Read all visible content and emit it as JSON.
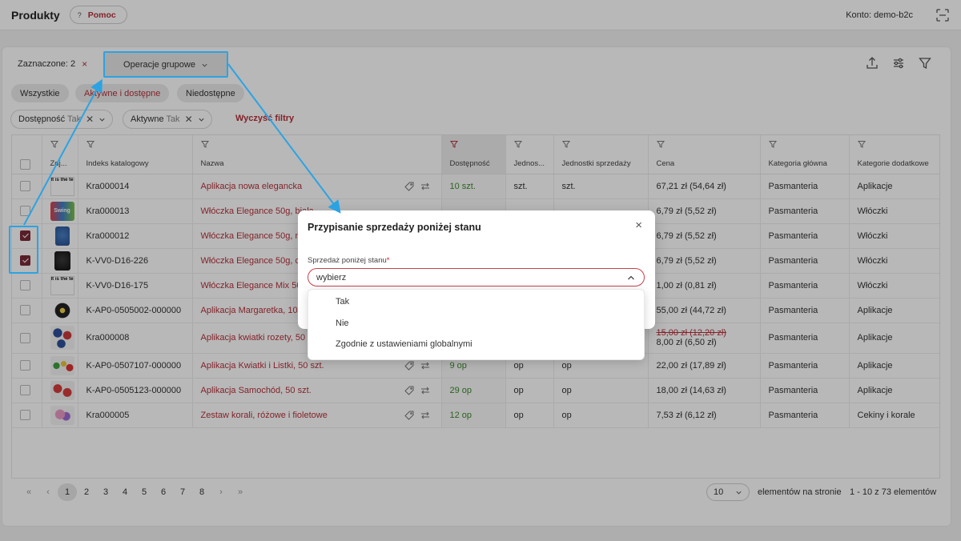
{
  "header": {
    "title": "Produkty",
    "help_label": "Pomoc",
    "account": "Konto: demo-b2c"
  },
  "selection": {
    "label": "Zaznaczone: 2",
    "clear_icon": "×",
    "group_ops_label": "Operacje grupowe"
  },
  "status_chips": [
    {
      "label": "Wszystkie",
      "active": false
    },
    {
      "label": "Aktywne i dostępne",
      "active": true
    },
    {
      "label": "Niedostępne",
      "active": false
    }
  ],
  "filter_chips": [
    {
      "name": "Dostępność",
      "value": "Tak"
    },
    {
      "name": "Aktywne",
      "value": "Tak"
    }
  ],
  "clear_filters_label": "Wyczyść filtry",
  "table": {
    "columns": [
      "",
      "Zdj...",
      "Indeks katalogowy",
      "Nazwa",
      "Dostępność",
      "Jednos...",
      "Jednostki sprzedaży",
      "Cena",
      "Kategoria główna",
      "Kategorie dodatkowe"
    ],
    "rows": [
      {
        "checked": false,
        "thumb": "It is the test image",
        "index": "Kra000014",
        "name": "Aplikacja nowa elegancka",
        "avail": "10 szt.",
        "unit": "szt.",
        "sale_unit": "szt.",
        "price": "67,21 zł (54,64 zł)",
        "old_price": "",
        "cat": "Pasmanteria",
        "extra": "Aplikacje"
      },
      {
        "checked": false,
        "thumb": "Swing",
        "index": "Kra000013",
        "name": "Włóczka Elegance 50g, biała",
        "avail": "",
        "unit": "",
        "sale_unit": "",
        "price": "6,79 zł (5,52 zł)",
        "old_price": "",
        "cat": "Pasmanteria",
        "extra": "Włóczki"
      },
      {
        "checked": true,
        "thumb": "",
        "index": "Kra000012",
        "name": "Włóczka Elegance 50g, niebieska",
        "avail": "",
        "unit": "",
        "sale_unit": "",
        "price": "6,79 zł (5,52 zł)",
        "old_price": "",
        "cat": "Pasmanteria",
        "extra": "Włóczki"
      },
      {
        "checked": true,
        "thumb": "",
        "index": "K-VV0-D16-226",
        "name": "Włóczka Elegance 50g, czarna",
        "avail": "",
        "unit": "",
        "sale_unit": "",
        "price": "6,79 zł (5,52 zł)",
        "old_price": "",
        "cat": "Pasmanteria",
        "extra": "Włóczki"
      },
      {
        "checked": false,
        "thumb": "It is the test image",
        "index": "K-VV0-D16-175",
        "name": "Włóczka Elegance Mix 50g",
        "avail": "",
        "unit": "",
        "sale_unit": "",
        "price": "1,00 zł (0,81 zł)",
        "old_price": "",
        "cat": "Pasmanteria",
        "extra": "Włóczki"
      },
      {
        "checked": false,
        "thumb": "",
        "index": "K-AP0-0505002-000000",
        "name": "Aplikacja Margaretka, 10 szt.",
        "avail": "",
        "unit": "",
        "sale_unit": "",
        "price": "55,00 zł (44,72 zł)",
        "old_price": "",
        "cat": "Pasmanteria",
        "extra": "Aplikacje"
      },
      {
        "checked": false,
        "thumb": "",
        "index": "Kra000008",
        "name": "Aplikacja kwiatki rozety, 50 szt.",
        "avail": "",
        "unit": "",
        "sale_unit": "",
        "price": "8,00 zł (6,50 zł)",
        "old_price": "15,00 zł (12,20 zł)",
        "cat": "Pasmanteria",
        "extra": "Aplikacje"
      },
      {
        "checked": false,
        "thumb": "",
        "index": "K-AP0-0507107-000000",
        "name": "Aplikacja Kwiatki i Listki, 50 szt.",
        "avail": "9 op",
        "unit": "op",
        "sale_unit": "op",
        "price": "22,00 zł (17,89 zł)",
        "old_price": "",
        "cat": "Pasmanteria",
        "extra": "Aplikacje"
      },
      {
        "checked": false,
        "thumb": "",
        "index": "K-AP0-0505123-000000",
        "name": "Aplikacja Samochód, 50 szt.",
        "avail": "29 op",
        "unit": "op",
        "sale_unit": "op",
        "price": "18,00 zł (14,63 zł)",
        "old_price": "",
        "cat": "Pasmanteria",
        "extra": "Aplikacje"
      },
      {
        "checked": false,
        "thumb": "",
        "index": "Kra000005",
        "name": "Zestaw korali, różowe i fioletowe",
        "avail": "12 op",
        "unit": "op",
        "sale_unit": "op",
        "price": "7,53 zł (6,12 zł)",
        "old_price": "",
        "cat": "Pasmanteria",
        "extra": "Cekiny i korale"
      }
    ]
  },
  "pagination": {
    "pages": [
      "1",
      "2",
      "3",
      "4",
      "5",
      "6",
      "7",
      "8"
    ],
    "current": "1",
    "per_page": "10",
    "per_page_label": "elementów na stronie",
    "range": "1 - 10 z 73 elementów"
  },
  "modal": {
    "title": "Przypisanie sprzedaży poniżej stanu",
    "field_label": "Sprzedaż poniżej stanu",
    "required_mark": "*",
    "select_value": "wybierz",
    "options": [
      "Tak",
      "Nie",
      "Zgodnie z ustawieniami globalnymi"
    ]
  },
  "colors": {
    "accent": "#b5313b",
    "annotation": "#2ba3e3",
    "available": "#3c8a2e",
    "checkbox_checked": "#7a2a37"
  }
}
